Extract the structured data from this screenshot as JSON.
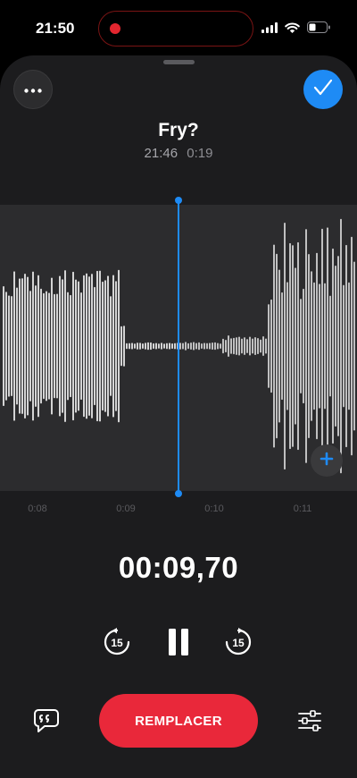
{
  "status_bar": {
    "time": "21:50",
    "recording_indicator_color": "#e3262f",
    "icons": [
      "signal-icon",
      "wifi-icon",
      "battery-icon"
    ]
  },
  "header": {
    "more_icon": "ellipsis-icon",
    "done_icon": "checkmark-icon",
    "title": "Fry?",
    "recorded_time": "21:46",
    "duration": "0:19"
  },
  "waveform": {
    "timeline_labels": [
      "0:08",
      "0:09",
      "0:10",
      "0:11"
    ],
    "add_icon": "plus-icon"
  },
  "playback": {
    "elapsed": "00:09,70",
    "skip_back_label": "15",
    "skip_forward_label": "15"
  },
  "footer": {
    "transcript_icon": "quote-bubble-icon",
    "replace_label": "REMPLACER",
    "options_icon": "sliders-icon"
  },
  "colors": {
    "accent": "#1e8bf5",
    "record": "#e9283a",
    "sheet": "#1c1c1e",
    "waveform_bg": "#2c2c2e"
  }
}
